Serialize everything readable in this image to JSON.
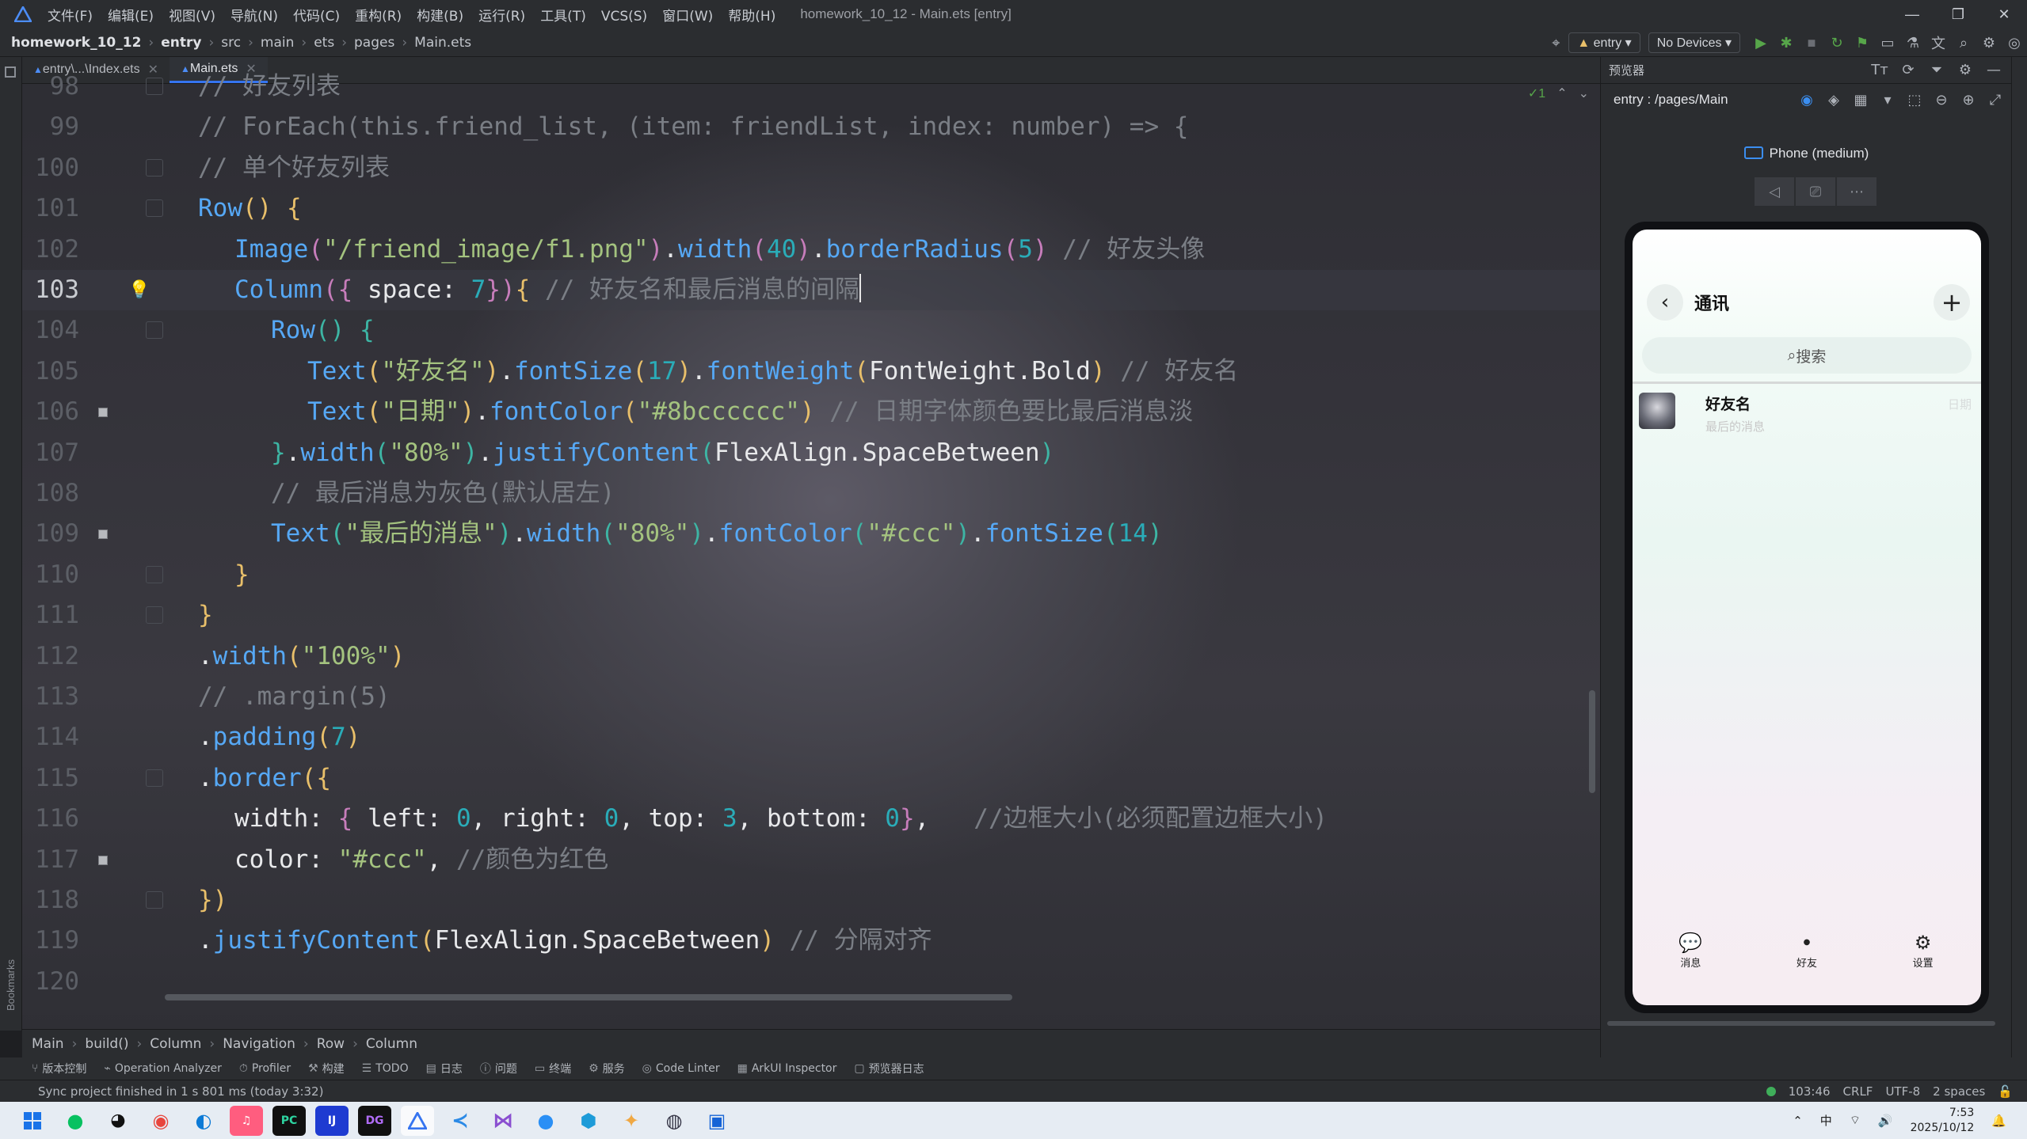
{
  "window": {
    "title": "homework_10_12 - Main.ets [entry]",
    "menu": [
      "文件(F)",
      "编辑(E)",
      "视图(V)",
      "导航(N)",
      "代码(C)",
      "重构(R)",
      "构建(B)",
      "运行(R)",
      "工具(T)",
      "VCS(S)",
      "窗口(W)",
      "帮助(H)"
    ]
  },
  "nav": {
    "crumbs": [
      "homework_10_12",
      "entry",
      "src",
      "main",
      "ets",
      "pages",
      "Main.ets"
    ],
    "module": "entry",
    "device": "No Devices"
  },
  "tabs": [
    {
      "label": "entry\\...\\Index.ets",
      "active": false
    },
    {
      "label": "Main.ets",
      "active": true
    }
  ],
  "editor": {
    "inspection": "✓1",
    "current_line": 103,
    "lines": [
      {
        "n": 98,
        "tokens": [
          [
            "cm",
            "// 好友列表"
          ]
        ],
        "indent": 0
      },
      {
        "n": 99,
        "tokens": [
          [
            "cm",
            "// ForEach(this.friend_list, (item: friendList, index: number) => {"
          ]
        ],
        "indent": 0
      },
      {
        "n": 100,
        "tokens": [
          [
            "cm",
            "// 单个好友列表"
          ]
        ],
        "indent": 0
      },
      {
        "n": 101,
        "tokens": [
          [
            "fn",
            "Row"
          ],
          [
            "br1",
            "()"
          ],
          [
            "ty",
            " "
          ],
          [
            "br1",
            "{"
          ]
        ],
        "indent": 0
      },
      {
        "n": 102,
        "tokens": [
          [
            "fn",
            "Image"
          ],
          [
            "br2",
            "("
          ],
          [
            "str",
            "\"/friend_image/f1.png\""
          ],
          [
            "br2",
            ")"
          ],
          [
            "ty",
            "."
          ],
          [
            "fn",
            "width"
          ],
          [
            "br2",
            "("
          ],
          [
            "num",
            "40"
          ],
          [
            "br2",
            ")"
          ],
          [
            "ty",
            "."
          ],
          [
            "fn",
            "borderRadius"
          ],
          [
            "br2",
            "("
          ],
          [
            "num",
            "5"
          ],
          [
            "br2",
            ")"
          ],
          [
            "cm",
            " // 好友头像"
          ]
        ],
        "indent": 1
      },
      {
        "n": 103,
        "tokens": [
          [
            "fn",
            "Column"
          ],
          [
            "br2",
            "({"
          ],
          [
            "ty",
            " space: "
          ],
          [
            "num",
            "7"
          ],
          [
            "br2",
            "})"
          ],
          [
            "br4",
            "{"
          ],
          [
            "cm",
            " // 好友名和最后消息的间隔"
          ]
        ],
        "indent": 1
      },
      {
        "n": 104,
        "tokens": [
          [
            "fn",
            "Row"
          ],
          [
            "br3",
            "()"
          ],
          [
            "ty",
            " "
          ],
          [
            "br3",
            "{"
          ]
        ],
        "indent": 2
      },
      {
        "n": 105,
        "tokens": [
          [
            "fn",
            "Text"
          ],
          [
            "br1",
            "("
          ],
          [
            "str",
            "\"好友名\""
          ],
          [
            "br1",
            ")"
          ],
          [
            "ty",
            "."
          ],
          [
            "fn",
            "fontSize"
          ],
          [
            "br1",
            "("
          ],
          [
            "num",
            "17"
          ],
          [
            "br1",
            ")"
          ],
          [
            "ty",
            "."
          ],
          [
            "fn",
            "fontWeight"
          ],
          [
            "br1",
            "("
          ],
          [
            "ty",
            "FontWeight.Bold"
          ],
          [
            "br1",
            ")"
          ],
          [
            "cm",
            " // 好友名"
          ]
        ],
        "indent": 3
      },
      {
        "n": 106,
        "tokens": [
          [
            "fn",
            "Text"
          ],
          [
            "br1",
            "("
          ],
          [
            "str",
            "\"日期\""
          ],
          [
            "br1",
            ")"
          ],
          [
            "ty",
            "."
          ],
          [
            "fn",
            "fontColor"
          ],
          [
            "br1",
            "("
          ],
          [
            "str",
            "\"#8bcccccc\""
          ],
          [
            "br1",
            ")"
          ],
          [
            "cm",
            " // 日期字体颜色要比最后消息淡"
          ]
        ],
        "indent": 3
      },
      {
        "n": 107,
        "tokens": [
          [
            "br3",
            "}"
          ],
          [
            "ty",
            "."
          ],
          [
            "fn",
            "width"
          ],
          [
            "br3",
            "("
          ],
          [
            "str",
            "\"80%\""
          ],
          [
            "br3",
            ")"
          ],
          [
            "ty",
            "."
          ],
          [
            "fn",
            "justifyContent"
          ],
          [
            "br3",
            "("
          ],
          [
            "ty",
            "FlexAlign.SpaceBetween"
          ],
          [
            "br3",
            ")"
          ]
        ],
        "indent": 2
      },
      {
        "n": 108,
        "tokens": [
          [
            "cm",
            "// 最后消息为灰色(默认居左)"
          ]
        ],
        "indent": 2
      },
      {
        "n": 109,
        "tokens": [
          [
            "fn",
            "Text"
          ],
          [
            "br3",
            "("
          ],
          [
            "str",
            "\"最后的消息\""
          ],
          [
            "br3",
            ")"
          ],
          [
            "ty",
            "."
          ],
          [
            "fn",
            "width"
          ],
          [
            "br3",
            "("
          ],
          [
            "str",
            "\"80%\""
          ],
          [
            "br3",
            ")"
          ],
          [
            "ty",
            "."
          ],
          [
            "fn",
            "fontColor"
          ],
          [
            "br3",
            "("
          ],
          [
            "str",
            "\"#ccc\""
          ],
          [
            "br3",
            ")"
          ],
          [
            "ty",
            "."
          ],
          [
            "fn",
            "fontSize"
          ],
          [
            "br3",
            "("
          ],
          [
            "num",
            "14"
          ],
          [
            "br3",
            ")"
          ]
        ],
        "indent": 2
      },
      {
        "n": 110,
        "tokens": [
          [
            "br4",
            "}"
          ]
        ],
        "indent": 1
      },
      {
        "n": 111,
        "tokens": [
          [
            "br1",
            "}"
          ]
        ],
        "indent": 0
      },
      {
        "n": 112,
        "tokens": [
          [
            "ty",
            "."
          ],
          [
            "fn",
            "width"
          ],
          [
            "br1",
            "("
          ],
          [
            "str",
            "\"100%\""
          ],
          [
            "br1",
            ")"
          ]
        ],
        "indent": 0
      },
      {
        "n": 113,
        "tokens": [
          [
            "cm",
            "// .margin(5)"
          ]
        ],
        "indent": 0
      },
      {
        "n": 114,
        "tokens": [
          [
            "ty",
            "."
          ],
          [
            "fn",
            "padding"
          ],
          [
            "br1",
            "("
          ],
          [
            "num",
            "7"
          ],
          [
            "br1",
            ")"
          ]
        ],
        "indent": 0
      },
      {
        "n": 115,
        "tokens": [
          [
            "ty",
            "."
          ],
          [
            "fn",
            "border"
          ],
          [
            "br1",
            "({"
          ]
        ],
        "indent": 0
      },
      {
        "n": 116,
        "tokens": [
          [
            "ty",
            "width: "
          ],
          [
            "br2",
            "{"
          ],
          [
            "ty",
            " left: "
          ],
          [
            "num",
            "0"
          ],
          [
            "ty",
            ", right: "
          ],
          [
            "num",
            "0"
          ],
          [
            "ty",
            ", top: "
          ],
          [
            "num",
            "3"
          ],
          [
            "ty",
            ", bottom: "
          ],
          [
            "num",
            "0"
          ],
          [
            "br2",
            "}"
          ],
          [
            "ty",
            ",   "
          ],
          [
            "cm",
            "//边框大小(必须配置边框大小)"
          ]
        ],
        "indent": 1
      },
      {
        "n": 117,
        "tokens": [
          [
            "ty",
            "color: "
          ],
          [
            "str",
            "\"#ccc\""
          ],
          [
            "ty",
            ", "
          ],
          [
            "cm",
            "//颜色为红色"
          ]
        ],
        "indent": 1
      },
      {
        "n": 118,
        "tokens": [
          [
            "br1",
            "})"
          ]
        ],
        "indent": 0
      },
      {
        "n": 119,
        "tokens": [
          [
            "ty",
            "."
          ],
          [
            "fn",
            "justifyContent"
          ],
          [
            "br1",
            "("
          ],
          [
            "ty",
            "FlexAlign.SpaceBetween"
          ],
          [
            "br1",
            ")"
          ],
          [
            "cm",
            " // 分隔对齐"
          ]
        ],
        "indent": 0
      },
      {
        "n": 120,
        "tokens": [],
        "indent": 0
      }
    ]
  },
  "breadcrumbs": [
    "Main",
    "build()",
    "Column",
    "Navigation",
    "Row",
    "Column"
  ],
  "preview": {
    "header": "预览器",
    "path": "entry : /pages/Main",
    "device_name": "Phone (medium)",
    "app": {
      "title": "通讯",
      "search_placeholder": "搜索",
      "friend_name": "好友名",
      "friend_msg": "最后的消息",
      "friend_date": "日期",
      "tabs": [
        {
          "icon": "message-icon",
          "glyph": "💬",
          "label": "消息"
        },
        {
          "icon": "friends-icon",
          "glyph": "●",
          "label": "好友"
        },
        {
          "icon": "settings-icon",
          "glyph": "⚙",
          "label": "设置"
        }
      ]
    }
  },
  "toolwindows": [
    {
      "icon": "⑂",
      "label": "版本控制"
    },
    {
      "icon": "⌁",
      "label": "Operation Analyzer"
    },
    {
      "icon": "⏱",
      "label": "Profiler"
    },
    {
      "icon": "⚒",
      "label": "构建"
    },
    {
      "icon": "☰",
      "label": "TODO"
    },
    {
      "icon": "▤",
      "label": "日志"
    },
    {
      "icon": "ⓘ",
      "label": "问题"
    },
    {
      "icon": "▭",
      "label": "终端"
    },
    {
      "icon": "⚙",
      "label": "服务"
    },
    {
      "icon": "◎",
      "label": "Code Linter"
    },
    {
      "icon": "▦",
      "label": "ArkUI Inspector"
    },
    {
      "icon": "▢",
      "label": "预览器日志"
    }
  ],
  "status": {
    "message": "Sync project finished in 1 s 801 ms (today 3:32)",
    "position": "103:46",
    "line_sep": "CRLF",
    "encoding": "UTF-8",
    "indent": "2 spaces"
  },
  "taskbar": {
    "ime": "中",
    "time": "7:53",
    "date": "2025/10/12"
  },
  "colors": {
    "fn": "#56a8f5",
    "str": "#a4c37f",
    "num": "#2aacb8",
    "cm": "#7a7e85",
    "accent": "#3574f0"
  }
}
